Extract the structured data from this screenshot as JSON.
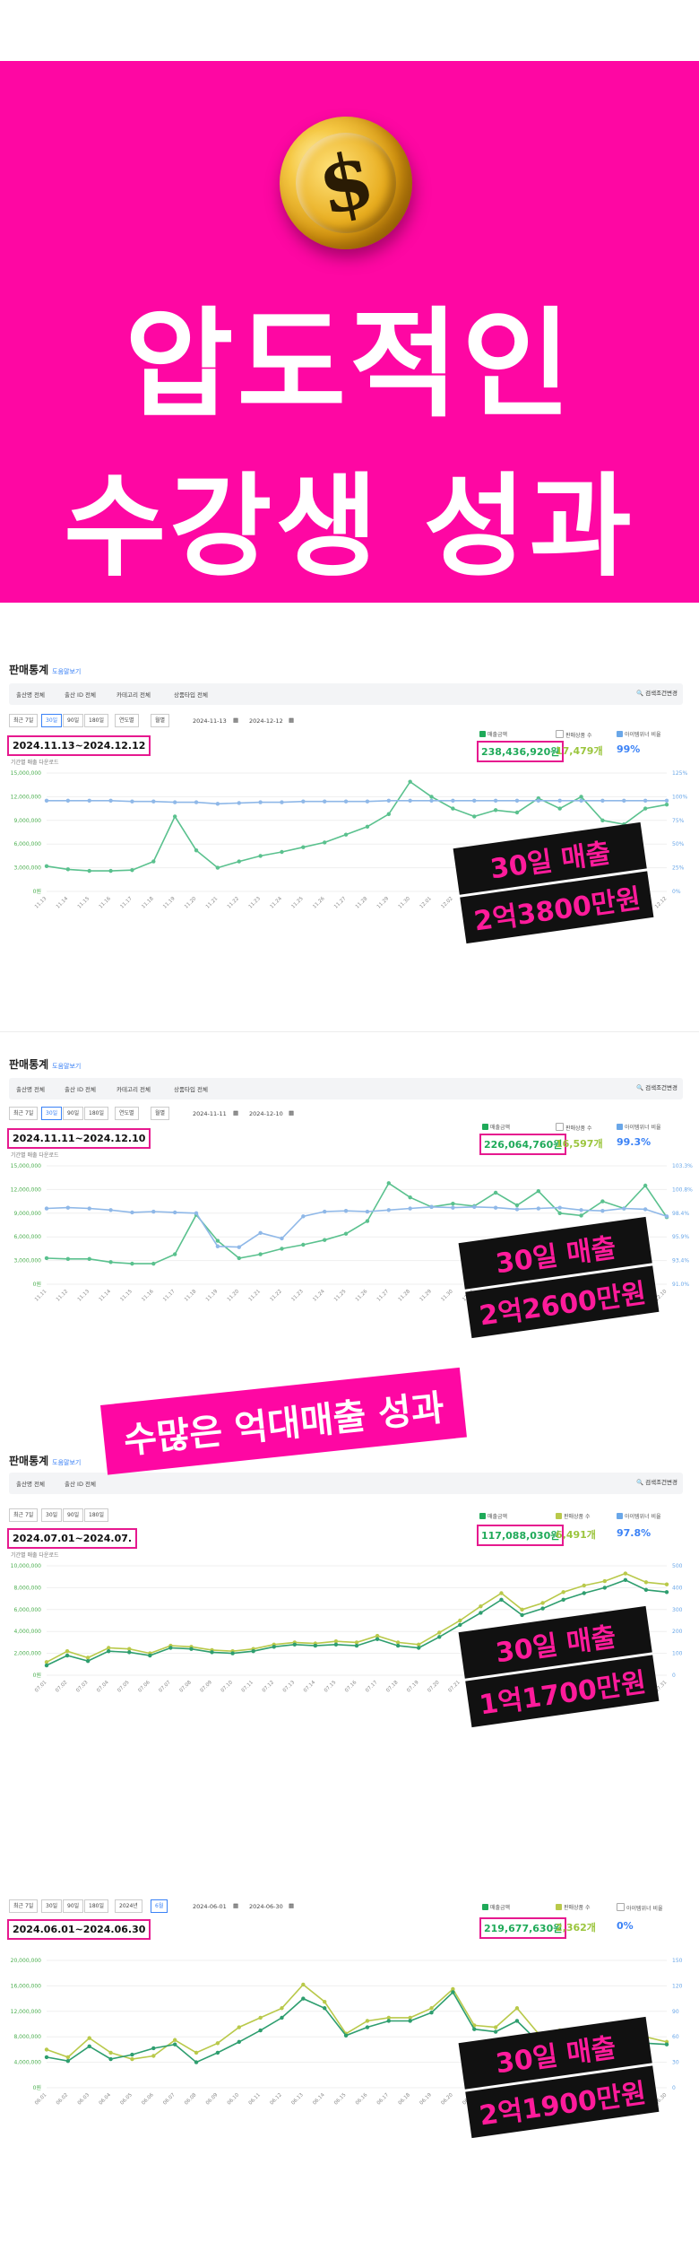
{
  "hero": {
    "coin_icon": "dollar-coin-icon",
    "coin_glyph": "$",
    "line1": "압도적인",
    "line2": "수강생 성과",
    "bg": "#fe07a3"
  },
  "overlay_banner": "수많은 억대매출 성과",
  "panels": [
    {
      "title": "판매통계",
      "title_link": "도움말보기",
      "filters": [
        "출산명 전체",
        "출산 ID 전체",
        "카테고리 전체",
        "상품타입 전체"
      ],
      "search_button": "검색조건변경",
      "period_buttons": [
        "최근 7일",
        "30일",
        "90일",
        "180일"
      ],
      "selected_period": "30일",
      "extra_controls": [
        "연도별",
        "월별"
      ],
      "date_from": "2024-11-13",
      "date_to": "2024-12-12",
      "range_label": "2024.11.13~2024.12.12",
      "note": "기간별 매출 다운로드",
      "stats": {
        "revenue": "238,436,920원",
        "items": "17,479개",
        "ratio": "99%"
      },
      "legend": [
        "매출금액",
        "판매상품 수",
        "아이템위너 비율"
      ],
      "badge_line1": "30일 매출",
      "badge_line2": "2억3800만원",
      "chart_data": {
        "type": "line",
        "y_left_ticks": [
          "15,000,000",
          "12,000,000",
          "9,000,000",
          "6,000,000",
          "3,000,000",
          "0원"
        ],
        "y_right_ticks": [
          "125%",
          "100%",
          "75%",
          "50%",
          "25%",
          "0%"
        ],
        "ylim": [
          0,
          15000000
        ],
        "categories": [
          "11.13",
          "11.14",
          "11.15",
          "11.16",
          "11.17",
          "11.18",
          "11.19",
          "11.20",
          "11.21",
          "11.22",
          "11.23",
          "11.24",
          "11.25",
          "11.26",
          "11.27",
          "11.28",
          "11.29",
          "11.30",
          "12.01",
          "12.02",
          "12.03",
          "12.04",
          "12.05",
          "12.06",
          "12.07",
          "12.08",
          "12.09",
          "12.10",
          "12.11",
          "12.12"
        ],
        "series": [
          {
            "color": "#5ac18e",
            "values": [
              3200000,
              2800000,
              2600000,
              2600000,
              2700000,
              3800000,
              9500000,
              5200000,
              3000000,
              3800000,
              4500000,
              5000000,
              5600000,
              6200000,
              7200000,
              8200000,
              9800000,
              13900000,
              12000000,
              10500000,
              9500000,
              10300000,
              10000000,
              11800000,
              10500000,
              12000000,
              9000000,
              8500000,
              10500000,
              11000000
            ]
          },
          {
            "color": "#8fb8e8",
            "values": [
              11500000,
              11500000,
              11500000,
              11500000,
              11400000,
              11400000,
              11300000,
              11300000,
              11100000,
              11200000,
              11300000,
              11300000,
              11400000,
              11400000,
              11400000,
              11400000,
              11500000,
              11500000,
              11500000,
              11500000,
              11500000,
              11500000,
              11500000,
              11500000,
              11500000,
              11500000,
              11500000,
              11500000,
              11500000,
              11500000
            ]
          }
        ]
      }
    },
    {
      "title": "판매통계",
      "title_link": "도움말보기",
      "filters": [
        "출산명 전체",
        "출산 ID 전체",
        "카테고리 전체",
        "상품타입 전체"
      ],
      "search_button": "검색조건변경",
      "period_buttons": [
        "최근 7일",
        "30일",
        "90일",
        "180일"
      ],
      "selected_period": "30일",
      "extra_controls": [
        "연도별",
        "월별"
      ],
      "date_from": "2024-11-11",
      "date_to": "2024-12-10",
      "range_label": "2024.11.11~2024.12.10",
      "note": "기간별 매출 다운로드",
      "stats": {
        "revenue": "226,064,760원",
        "items": "16,597개",
        "ratio": "99.3%"
      },
      "legend": [
        "매출금액",
        "판매상품 수",
        "아이템위너 비율"
      ],
      "badge_line1": "30일 매출",
      "badge_line2": "2억2600만원",
      "chart_data": {
        "type": "line",
        "y_left_ticks": [
          "15,000,000",
          "12,000,000",
          "9,000,000",
          "6,000,000",
          "3,000,000",
          "0원"
        ],
        "y_right_ticks": [
          "103.3%",
          "100.8%",
          "98.4%",
          "95.9%",
          "93.4%",
          "91.0%"
        ],
        "ylim": [
          0,
          15000000
        ],
        "categories": [
          "11.11",
          "11.12",
          "11.13",
          "11.14",
          "11.15",
          "11.16",
          "11.17",
          "11.18",
          "11.19",
          "11.20",
          "11.21",
          "11.22",
          "11.23",
          "11.24",
          "11.25",
          "11.26",
          "11.27",
          "11.28",
          "11.29",
          "11.30",
          "12.01",
          "12.02",
          "12.03",
          "12.04",
          "12.05",
          "12.06",
          "12.07",
          "12.08",
          "12.09",
          "12.10"
        ],
        "series": [
          {
            "color": "#5ac18e",
            "values": [
              3300000,
              3200000,
              3200000,
              2800000,
              2600000,
              2600000,
              3800000,
              8800000,
              5500000,
              3300000,
              3800000,
              4500000,
              5000000,
              5600000,
              6400000,
              8000000,
              12800000,
              11000000,
              9800000,
              10200000,
              9900000,
              11600000,
              10000000,
              11800000,
              9000000,
              8700000,
              10500000,
              9600000,
              12500000,
              8500000
            ]
          },
          {
            "color": "#8fb8e8",
            "values": [
              9600000,
              9700000,
              9600000,
              9400000,
              9100000,
              9200000,
              9100000,
              9000000,
              4800000,
              4700000,
              6500000,
              5800000,
              8600000,
              9200000,
              9300000,
              9200000,
              9400000,
              9600000,
              9800000,
              9700000,
              9800000,
              9700000,
              9500000,
              9600000,
              9700000,
              9400000,
              9300000,
              9600000,
              9500000,
              8600000
            ]
          }
        ]
      }
    },
    {
      "title": "판매통계",
      "title_link": "도움말보기",
      "filters": [
        "출산명 전체",
        "출산 ID 전체"
      ],
      "search_button": "검색조건변경",
      "period_buttons": [
        "최근 7일",
        "30일",
        "90일",
        "180일"
      ],
      "selected_period": "",
      "extra_controls": [],
      "date_from": "",
      "date_to": "",
      "range_label": "2024.07.01~2024.07.",
      "note": "기간별 매출 다운로드",
      "stats": {
        "revenue": "117,088,030원",
        "items": "6,491개",
        "ratio": "97.8%"
      },
      "legend": [
        "매출금액",
        "판매상품 수",
        "아이템위너 비율"
      ],
      "badge_line1": "30일 매출",
      "badge_line2": "1억1700만원",
      "chart_data": {
        "type": "line",
        "y_left_ticks": [
          "10,000,000",
          "8,000,000",
          "6,000,000",
          "4,000,000",
          "2,000,000",
          "0원"
        ],
        "y_right_ticks": [
          "500",
          "400",
          "300",
          "200",
          "100",
          "0"
        ],
        "ylim": [
          0,
          10000000
        ],
        "categories": [
          "07.01",
          "07.02",
          "07.03",
          "07.04",
          "07.05",
          "07.06",
          "07.07",
          "07.08",
          "07.09",
          "07.10",
          "07.11",
          "07.12",
          "07.13",
          "07.14",
          "07.15",
          "07.16",
          "07.17",
          "07.18",
          "07.19",
          "07.20",
          "07.21",
          "07.22",
          "07.23",
          "07.24",
          "07.25",
          "07.26",
          "07.27",
          "07.28",
          "07.29",
          "07.30",
          "07.31"
        ],
        "series": [
          {
            "color": "#b9c94a",
            "values": [
              1200000,
              2200000,
              1600000,
              2500000,
              2400000,
              2000000,
              2700000,
              2600000,
              2300000,
              2200000,
              2400000,
              2800000,
              3000000,
              2900000,
              3100000,
              3000000,
              3600000,
              3000000,
              2800000,
              3900000,
              5000000,
              6300000,
              7500000,
              6000000,
              6600000,
              7600000,
              8200000,
              8600000,
              9300000,
              8500000,
              8300000
            ]
          },
          {
            "color": "#2e9e6f",
            "values": [
              900000,
              1800000,
              1300000,
              2200000,
              2100000,
              1800000,
              2500000,
              2400000,
              2100000,
              2000000,
              2200000,
              2600000,
              2800000,
              2700000,
              2800000,
              2700000,
              3300000,
              2700000,
              2500000,
              3500000,
              4600000,
              5700000,
              6900000,
              5500000,
              6100000,
              6900000,
              7500000,
              8000000,
              8700000,
              7800000,
              7600000
            ]
          }
        ]
      }
    },
    {
      "title": "",
      "title_link": "",
      "filters": [],
      "search_button": "",
      "period_buttons": [
        "최근 7일",
        "30일",
        "90일",
        "180일"
      ],
      "selected_period": "",
      "extra_controls": [
        "2024년",
        "6월"
      ],
      "date_from": "2024-06-01",
      "date_to": "2024-06-30",
      "range_label": "2024.06.01~2024.06.30",
      "note": "",
      "stats": {
        "revenue": "219,677,630원",
        "items": "2,362개",
        "ratio": "0%"
      },
      "legend": [
        "매출금액",
        "판매상품 수",
        "아이템위너 비율"
      ],
      "badge_line1": "30일 매출",
      "badge_line2": "2억1900만원",
      "chart_data": {
        "type": "line",
        "y_left_ticks": [
          "20,000,000",
          "16,000,000",
          "12,000,000",
          "8,000,000",
          "4,000,000",
          "0원"
        ],
        "y_right_ticks": [
          "150",
          "120",
          "90",
          "60",
          "30",
          "0"
        ],
        "ylim": [
          0,
          20000000
        ],
        "categories": [
          "06.01",
          "06.02",
          "06.03",
          "06.04",
          "06.05",
          "06.06",
          "06.07",
          "06.08",
          "06.09",
          "06.10",
          "06.11",
          "06.12",
          "06.13",
          "06.14",
          "06.15",
          "06.16",
          "06.17",
          "06.18",
          "06.19",
          "06.20",
          "06.21",
          "06.22",
          "06.23",
          "06.24",
          "06.25",
          "06.26",
          "06.27",
          "06.28",
          "06.29",
          "06.30"
        ],
        "series": [
          {
            "color": "#b9c94a",
            "values": [
              6000000,
              4800000,
              7800000,
              5500000,
              4500000,
              5000000,
              7500000,
              5500000,
              7000000,
              9500000,
              11000000,
              12500000,
              16200000,
              13500000,
              8500000,
              10500000,
              11000000,
              11000000,
              12500000,
              15500000,
              9800000,
              9500000,
              12500000,
              8500000,
              9000000,
              7000000,
              8200000,
              7500000,
              8000000,
              7200000
            ]
          },
          {
            "color": "#2e9e6f",
            "values": [
              4800000,
              4200000,
              6500000,
              4500000,
              5200000,
              6200000,
              6800000,
              4000000,
              5500000,
              7200000,
              9000000,
              11000000,
              14000000,
              12500000,
              8200000,
              9500000,
              10500000,
              10500000,
              11800000,
              15000000,
              9200000,
              8800000,
              10500000,
              7200000,
              8200000,
              6200000,
              7200000,
              6800000,
              7000000,
              6800000
            ]
          }
        ]
      }
    }
  ]
}
